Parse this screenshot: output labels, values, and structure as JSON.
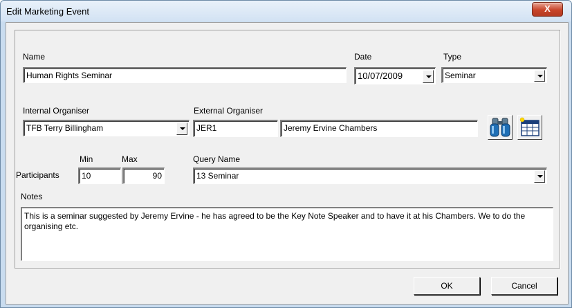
{
  "window": {
    "title": "Edit Marketing Event",
    "close_glyph": "X"
  },
  "form": {
    "name_label": "Name",
    "name_value": "Human Rights Seminar",
    "date_label": "Date",
    "date_value": "10/07/2009",
    "type_label": "Type",
    "type_value": "Seminar",
    "internal_label": "Internal Organiser",
    "internal_value": "TFB Terry Billingham",
    "external_label": "External Organiser",
    "external_code": "JER1",
    "external_name": "Jeremy Ervine Chambers",
    "min_label": "Min",
    "max_label": "Max",
    "participants_label": "Participants",
    "min_value": "10",
    "max_value": "90",
    "query_label": "Query Name",
    "query_value": "13 Seminar",
    "notes_label": "Notes",
    "notes_value": "This is a seminar suggested by Jeremy Ervine - he has agreed to be the Key Note Speaker and to have it at his Chambers.  We to do the organising etc."
  },
  "buttons": {
    "ok": "OK",
    "cancel": "Cancel"
  },
  "icons": {
    "search": "binoculars-icon",
    "table": "table-icon"
  }
}
